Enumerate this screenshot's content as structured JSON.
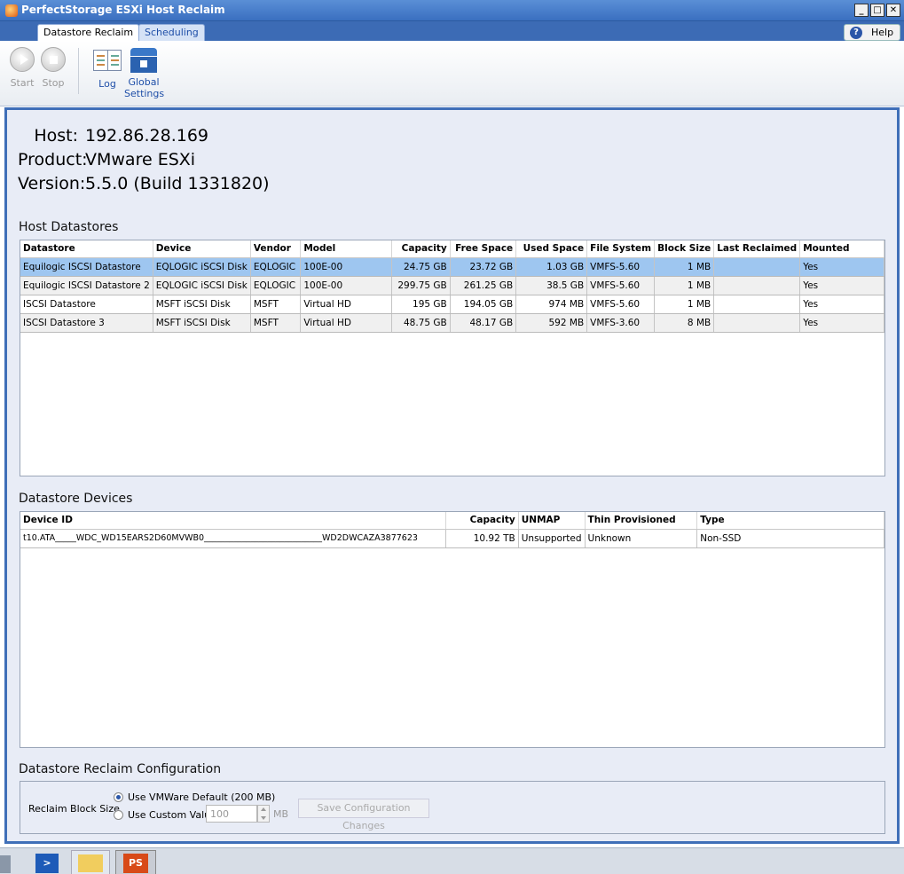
{
  "window": {
    "title": "PerfectStorage ESXi Host Reclaim",
    "controls": [
      "_",
      "□",
      "✕"
    ]
  },
  "tabs": [
    {
      "label": "Datastore Reclaim",
      "active": true
    },
    {
      "label": "Scheduling",
      "active": false
    }
  ],
  "help": {
    "label": "Help",
    "icon": "?"
  },
  "toolbar": {
    "start": {
      "label": "Start",
      "icon": "play-icon",
      "enabled": false
    },
    "stop": {
      "label": "Stop",
      "icon": "stop-icon",
      "enabled": false
    },
    "log": {
      "label": "Log",
      "icon": "log-book-icon"
    },
    "global_settings": {
      "label_line1": "Global",
      "label_line2": "Settings",
      "icon": "toolbox-icon"
    }
  },
  "host_info": {
    "host_label": "Host:",
    "host_value": "192.86.28.169",
    "product_label": "Product:",
    "product_value": "VMware ESXi",
    "version_label": "Version:",
    "version_value": "5.5.0 (Build 1331820)"
  },
  "host_datastores": {
    "title": "Host Datastores",
    "columns": [
      "Datastore",
      "Device",
      "Vendor",
      "Model",
      "Capacity",
      "Free Space",
      "Used Space",
      "File System",
      "Block Size",
      "Last Reclaimed",
      "Mounted"
    ],
    "rows": [
      [
        "Equilogic ISCSI Datastore",
        "EQLOGIC iSCSI Disk",
        "EQLOGIC",
        "100E-00",
        "24.75 GB",
        "23.72 GB",
        "1.03 GB",
        "VMFS-5.60",
        "1 MB",
        "",
        "Yes"
      ],
      [
        "Equilogic ISCSI Datastore 2",
        "EQLOGIC iSCSI Disk",
        "EQLOGIC",
        "100E-00",
        "299.75 GB",
        "261.25 GB",
        "38.5 GB",
        "VMFS-5.60",
        "1 MB",
        "",
        "Yes"
      ],
      [
        "ISCSI Datastore",
        "MSFT iSCSI Disk",
        "MSFT",
        "Virtual HD",
        "195 GB",
        "194.05 GB",
        "974 MB",
        "VMFS-5.60",
        "1 MB",
        "",
        "Yes"
      ],
      [
        "ISCSI Datastore 3",
        "MSFT iSCSI Disk",
        "MSFT",
        "Virtual HD",
        "48.75 GB",
        "48.17 GB",
        "592 MB",
        "VMFS-3.60",
        "8 MB",
        "",
        "Yes"
      ]
    ],
    "selected_row": 0
  },
  "datastore_devices": {
    "title": "Datastore Devices",
    "columns": [
      "Device ID",
      "Capacity",
      "UNMAP",
      "Thin Provisioned",
      "Type"
    ],
    "rows": [
      [
        "t10.ATA_____WDC_WD15EARS2D60MVWB0____________________________WD2DWCAZA3877623",
        "10.92 TB",
        "Unsupported",
        "Unknown",
        "Non-SSD"
      ]
    ]
  },
  "reclaim_config": {
    "title": "Datastore Reclaim Configuration",
    "block_size_label": "Reclaim Block Size",
    "option_default": "Use VMWare Default (200 MB)",
    "option_custom": "Use Custom Value",
    "custom_value": "100",
    "unit": "MB",
    "selected": "default",
    "save_label": "Save Configuration Changes"
  }
}
